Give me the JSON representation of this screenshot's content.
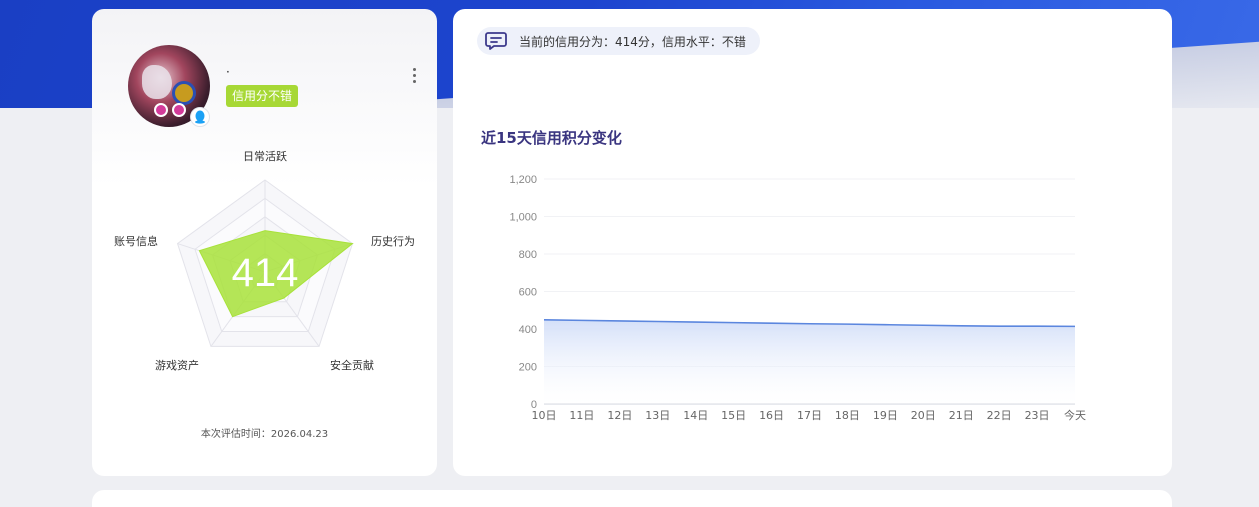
{
  "profile": {
    "nickname": "·",
    "badge": "信用分不错",
    "score": "414",
    "eval_time_label": "本次评估时间：",
    "eval_time_value": "2026.04.23"
  },
  "radar": {
    "axes": [
      "日常活跃",
      "历史行为",
      "安全贡献",
      "游戏资产",
      "账号信息"
    ],
    "values": [
      0.45,
      1.0,
      0.35,
      0.6,
      0.75
    ],
    "max": 1,
    "fill_color": "#a8e23a"
  },
  "notice": {
    "text": "当前的信用分为：414分，信用水平：不错"
  },
  "chart_data": {
    "type": "area",
    "title": "近15天信用积分变化",
    "categories": [
      "10日",
      "11日",
      "12日",
      "13日",
      "14日",
      "15日",
      "16日",
      "17日",
      "18日",
      "19日",
      "20日",
      "21日",
      "22日",
      "23日",
      "今天"
    ],
    "series": [
      {
        "values": [
          449,
          446,
          443,
          440,
          437,
          434,
          431,
          428,
          426,
          423,
          420,
          417,
          415,
          415,
          414
        ]
      }
    ],
    "ylim": [
      0,
      1200
    ],
    "yticks": [
      0,
      200,
      400,
      600,
      800,
      1000,
      1200
    ],
    "ytick_labels": [
      "0",
      "200",
      "400",
      "600",
      "800",
      "1,000",
      "1,200"
    ],
    "grid": true,
    "line_color": "#5b86de",
    "area_color": "#cfdcf8"
  }
}
